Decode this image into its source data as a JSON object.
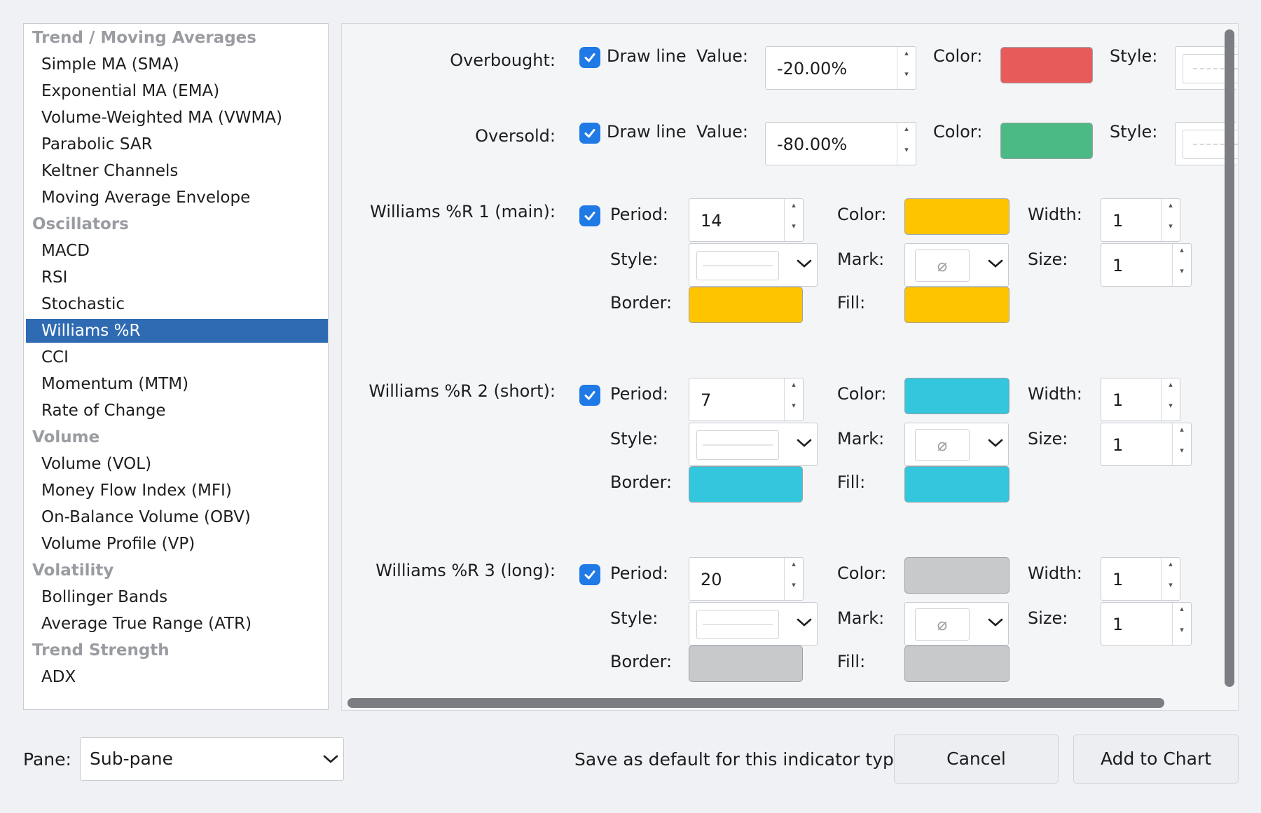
{
  "sidebar": {
    "rows": [
      {
        "type": "cat",
        "label": "Trend / Moving Averages"
      },
      {
        "type": "item",
        "label": "Simple MA (SMA)"
      },
      {
        "type": "item",
        "label": "Exponential MA (EMA)"
      },
      {
        "type": "item",
        "label": "Volume-Weighted MA (VWMA)"
      },
      {
        "type": "item",
        "label": "Parabolic SAR"
      },
      {
        "type": "item",
        "label": "Keltner Channels"
      },
      {
        "type": "item",
        "label": "Moving Average Envelope"
      },
      {
        "type": "cat",
        "label": "Oscillators"
      },
      {
        "type": "item",
        "label": "MACD"
      },
      {
        "type": "item",
        "label": "RSI"
      },
      {
        "type": "item",
        "label": "Stochastic"
      },
      {
        "type": "item",
        "label": "Williams %R",
        "selected": true
      },
      {
        "type": "item",
        "label": "CCI"
      },
      {
        "type": "item",
        "label": "Momentum (MTM)"
      },
      {
        "type": "item",
        "label": "Rate of Change"
      },
      {
        "type": "cat",
        "label": "Volume"
      },
      {
        "type": "item",
        "label": "Volume (VOL)"
      },
      {
        "type": "item",
        "label": "Money Flow Index (MFI)"
      },
      {
        "type": "item",
        "label": "On-Balance Volume (OBV)"
      },
      {
        "type": "item",
        "label": "Volume Profile (VP)"
      },
      {
        "type": "cat",
        "label": "Volatility"
      },
      {
        "type": "item",
        "label": "Bollinger Bands"
      },
      {
        "type": "item",
        "label": "Average True Range (ATR)"
      },
      {
        "type": "cat",
        "label": "Trend Strength"
      },
      {
        "type": "item",
        "label": "ADX"
      }
    ]
  },
  "levels": {
    "overbought": {
      "label": "Overbought:",
      "draw_line_label": "Draw line",
      "value_label": "Value:",
      "value": "-20.00%",
      "color_label": "Color:",
      "color": "#e85b5b",
      "style_label": "Style:"
    },
    "oversold": {
      "label": "Oversold:",
      "draw_line_label": "Draw line",
      "value_label": "Value:",
      "value": "-80.00%",
      "color_label": "Color:",
      "color": "#4cba85",
      "style_label": "Style:"
    }
  },
  "series": [
    {
      "label": "Williams %R 1 (main):",
      "period": "14",
      "color": "#ffc400"
    },
    {
      "label": "Williams %R 2 (short):",
      "period": "7",
      "color": "#33c6dc"
    },
    {
      "label": "Williams %R 3 (long):",
      "period": "20",
      "color": "#c8c9cb"
    }
  ],
  "series_fields": {
    "period_label": "Period:",
    "color_label": "Color:",
    "width_label": "Width:",
    "width_value": "1",
    "style_label": "Style:",
    "mark_label": "Mark:",
    "size_label": "Size:",
    "size_value": "1",
    "border_label": "Border:",
    "fill_label": "Fill:",
    "mark_glyph": "⌀"
  },
  "footer": {
    "pane_label": "Pane:",
    "pane_value": "Sub-pane",
    "save_default_label": "Save as default for this indicator type",
    "cancel_label": "Cancel",
    "add_label": "Add to Chart"
  }
}
